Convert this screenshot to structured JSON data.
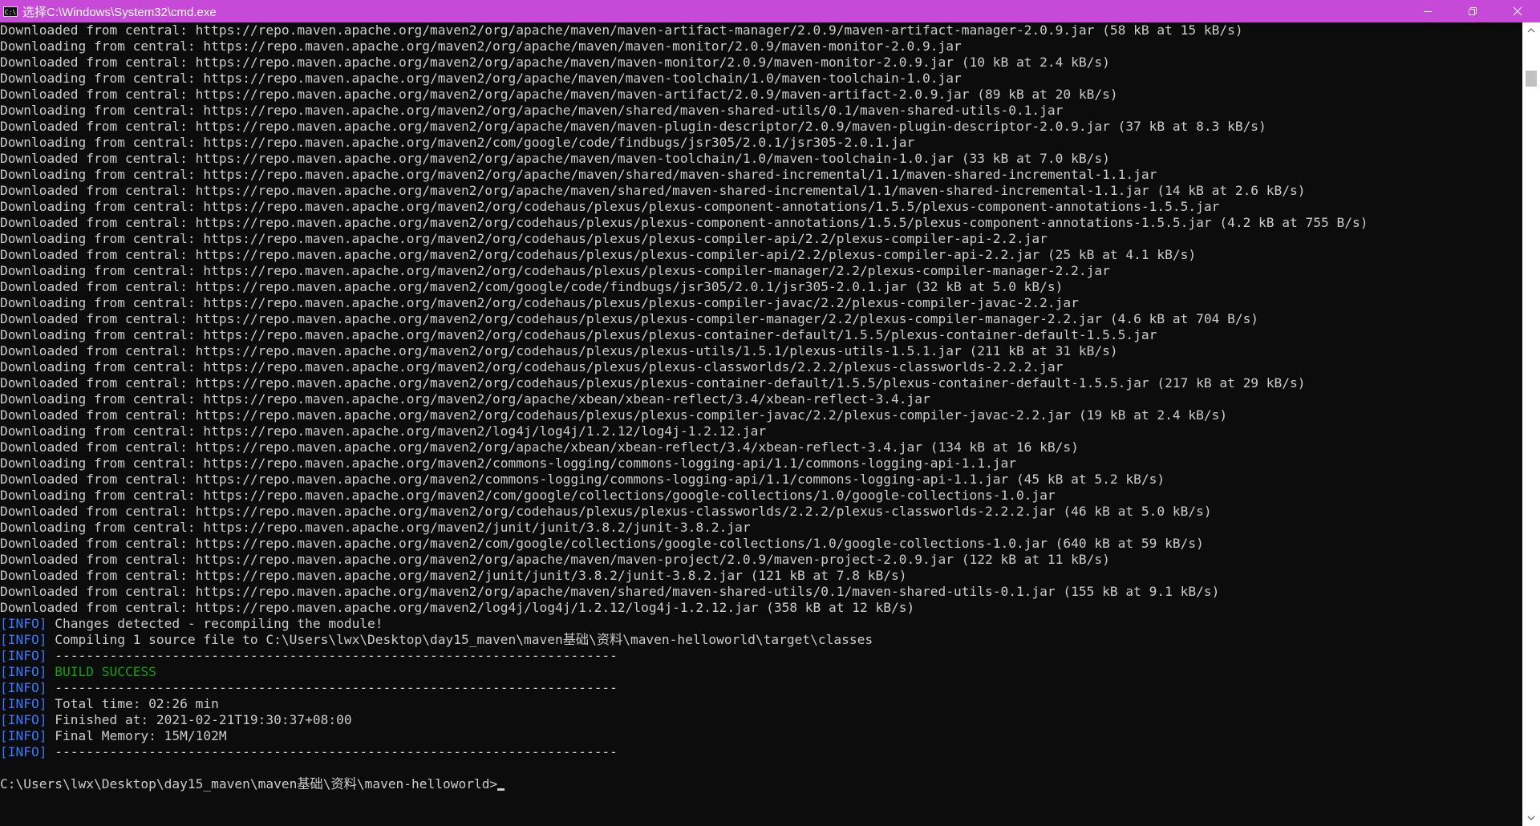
{
  "window": {
    "title": "选择C:\\Windows\\System32\\cmd.exe",
    "app_icon_text": "C:\\",
    "app_icon": "cmd-icon",
    "minimize_icon": "minimize-icon",
    "restore_icon": "restore-icon",
    "close_icon": "close-icon"
  },
  "colors": {
    "titlebar": "#c64ad7",
    "background": "#0c0c0c",
    "text": "#cccccc",
    "info": "#3b78ff",
    "success": "#13a10e"
  },
  "console": {
    "lines": [
      "Downloaded from central: https://repo.maven.apache.org/maven2/org/apache/maven/maven-artifact-manager/2.0.9/maven-artifact-manager-2.0.9.jar (58 kB at 15 kB/s)",
      "Downloading from central: https://repo.maven.apache.org/maven2/org/apache/maven/maven-monitor/2.0.9/maven-monitor-2.0.9.jar",
      "Downloaded from central: https://repo.maven.apache.org/maven2/org/apache/maven/maven-monitor/2.0.9/maven-monitor-2.0.9.jar (10 kB at 2.4 kB/s)",
      "Downloading from central: https://repo.maven.apache.org/maven2/org/apache/maven/maven-toolchain/1.0/maven-toolchain-1.0.jar",
      "Downloaded from central: https://repo.maven.apache.org/maven2/org/apache/maven/maven-artifact/2.0.9/maven-artifact-2.0.9.jar (89 kB at 20 kB/s)",
      "Downloading from central: https://repo.maven.apache.org/maven2/org/apache/maven/shared/maven-shared-utils/0.1/maven-shared-utils-0.1.jar",
      "Downloaded from central: https://repo.maven.apache.org/maven2/org/apache/maven/maven-plugin-descriptor/2.0.9/maven-plugin-descriptor-2.0.9.jar (37 kB at 8.3 kB/s)",
      "Downloading from central: https://repo.maven.apache.org/maven2/com/google/code/findbugs/jsr305/2.0.1/jsr305-2.0.1.jar",
      "Downloaded from central: https://repo.maven.apache.org/maven2/org/apache/maven/maven-toolchain/1.0/maven-toolchain-1.0.jar (33 kB at 7.0 kB/s)",
      "Downloading from central: https://repo.maven.apache.org/maven2/org/apache/maven/shared/maven-shared-incremental/1.1/maven-shared-incremental-1.1.jar",
      "Downloaded from central: https://repo.maven.apache.org/maven2/org/apache/maven/shared/maven-shared-incremental/1.1/maven-shared-incremental-1.1.jar (14 kB at 2.6 kB/s)",
      "Downloading from central: https://repo.maven.apache.org/maven2/org/codehaus/plexus/plexus-component-annotations/1.5.5/plexus-component-annotations-1.5.5.jar",
      "Downloaded from central: https://repo.maven.apache.org/maven2/org/codehaus/plexus/plexus-component-annotations/1.5.5/plexus-component-annotations-1.5.5.jar (4.2 kB at 755 B/s)",
      "Downloading from central: https://repo.maven.apache.org/maven2/org/codehaus/plexus/plexus-compiler-api/2.2/plexus-compiler-api-2.2.jar",
      "Downloaded from central: https://repo.maven.apache.org/maven2/org/codehaus/plexus/plexus-compiler-api/2.2/plexus-compiler-api-2.2.jar (25 kB at 4.1 kB/s)",
      "Downloading from central: https://repo.maven.apache.org/maven2/org/codehaus/plexus/plexus-compiler-manager/2.2/plexus-compiler-manager-2.2.jar",
      "Downloaded from central: https://repo.maven.apache.org/maven2/com/google/code/findbugs/jsr305/2.0.1/jsr305-2.0.1.jar (32 kB at 5.0 kB/s)",
      "Downloading from central: https://repo.maven.apache.org/maven2/org/codehaus/plexus/plexus-compiler-javac/2.2/plexus-compiler-javac-2.2.jar",
      "Downloaded from central: https://repo.maven.apache.org/maven2/org/codehaus/plexus/plexus-compiler-manager/2.2/plexus-compiler-manager-2.2.jar (4.6 kB at 704 B/s)",
      "Downloading from central: https://repo.maven.apache.org/maven2/org/codehaus/plexus/plexus-container-default/1.5.5/plexus-container-default-1.5.5.jar",
      "Downloaded from central: https://repo.maven.apache.org/maven2/org/codehaus/plexus/plexus-utils/1.5.1/plexus-utils-1.5.1.jar (211 kB at 31 kB/s)",
      "Downloading from central: https://repo.maven.apache.org/maven2/org/codehaus/plexus/plexus-classworlds/2.2.2/plexus-classworlds-2.2.2.jar",
      "Downloaded from central: https://repo.maven.apache.org/maven2/org/codehaus/plexus/plexus-container-default/1.5.5/plexus-container-default-1.5.5.jar (217 kB at 29 kB/s)",
      "Downloading from central: https://repo.maven.apache.org/maven2/org/apache/xbean/xbean-reflect/3.4/xbean-reflect-3.4.jar",
      "Downloaded from central: https://repo.maven.apache.org/maven2/org/codehaus/plexus/plexus-compiler-javac/2.2/plexus-compiler-javac-2.2.jar (19 kB at 2.4 kB/s)",
      "Downloading from central: https://repo.maven.apache.org/maven2/log4j/log4j/1.2.12/log4j-1.2.12.jar",
      "Downloaded from central: https://repo.maven.apache.org/maven2/org/apache/xbean/xbean-reflect/3.4/xbean-reflect-3.4.jar (134 kB at 16 kB/s)",
      "Downloading from central: https://repo.maven.apache.org/maven2/commons-logging/commons-logging-api/1.1/commons-logging-api-1.1.jar",
      "Downloaded from central: https://repo.maven.apache.org/maven2/commons-logging/commons-logging-api/1.1/commons-logging-api-1.1.jar (45 kB at 5.2 kB/s)",
      "Downloading from central: https://repo.maven.apache.org/maven2/com/google/collections/google-collections/1.0/google-collections-1.0.jar",
      "Downloaded from central: https://repo.maven.apache.org/maven2/org/codehaus/plexus/plexus-classworlds/2.2.2/plexus-classworlds-2.2.2.jar (46 kB at 5.0 kB/s)",
      "Downloading from central: https://repo.maven.apache.org/maven2/junit/junit/3.8.2/junit-3.8.2.jar",
      "Downloaded from central: https://repo.maven.apache.org/maven2/com/google/collections/google-collections/1.0/google-collections-1.0.jar (640 kB at 59 kB/s)",
      "Downloaded from central: https://repo.maven.apache.org/maven2/org/apache/maven/maven-project/2.0.9/maven-project-2.0.9.jar (122 kB at 11 kB/s)",
      "Downloaded from central: https://repo.maven.apache.org/maven2/junit/junit/3.8.2/junit-3.8.2.jar (121 kB at 7.8 kB/s)",
      "Downloaded from central: https://repo.maven.apache.org/maven2/org/apache/maven/shared/maven-shared-utils/0.1/maven-shared-utils-0.1.jar (155 kB at 9.1 kB/s)",
      "Downloaded from central: https://repo.maven.apache.org/maven2/log4j/log4j/1.2.12/log4j-1.2.12.jar (358 kB at 12 kB/s)"
    ],
    "info_tag": "[INFO]",
    "info_lines": [
      {
        "text": "Changes detected - recompiling the module!",
        "style": "normal"
      },
      {
        "text": "Compiling 1 source file to C:\\Users\\lwx\\Desktop\\day15_maven\\maven基础\\资料\\maven-helloworld\\target\\classes",
        "style": "normal"
      },
      {
        "text": "------------------------------------------------------------------------",
        "style": "normal"
      },
      {
        "text": "BUILD SUCCESS",
        "style": "success"
      },
      {
        "text": "------------------------------------------------------------------------",
        "style": "normal"
      },
      {
        "text": "Total time: 02:26 min",
        "style": "normal"
      },
      {
        "text": "Finished at: 2021-02-21T19:30:37+08:00",
        "style": "normal"
      },
      {
        "text": "Final Memory: 15M/102M",
        "style": "normal"
      },
      {
        "text": "------------------------------------------------------------------------",
        "style": "normal"
      }
    ],
    "prompt": "C:\\Users\\lwx\\Desktop\\day15_maven\\maven基础\\资料\\maven-helloworld>"
  },
  "scrollbar": {
    "up_icon": "scroll-up-arrow-icon",
    "down_icon": "scroll-down-arrow-icon"
  }
}
